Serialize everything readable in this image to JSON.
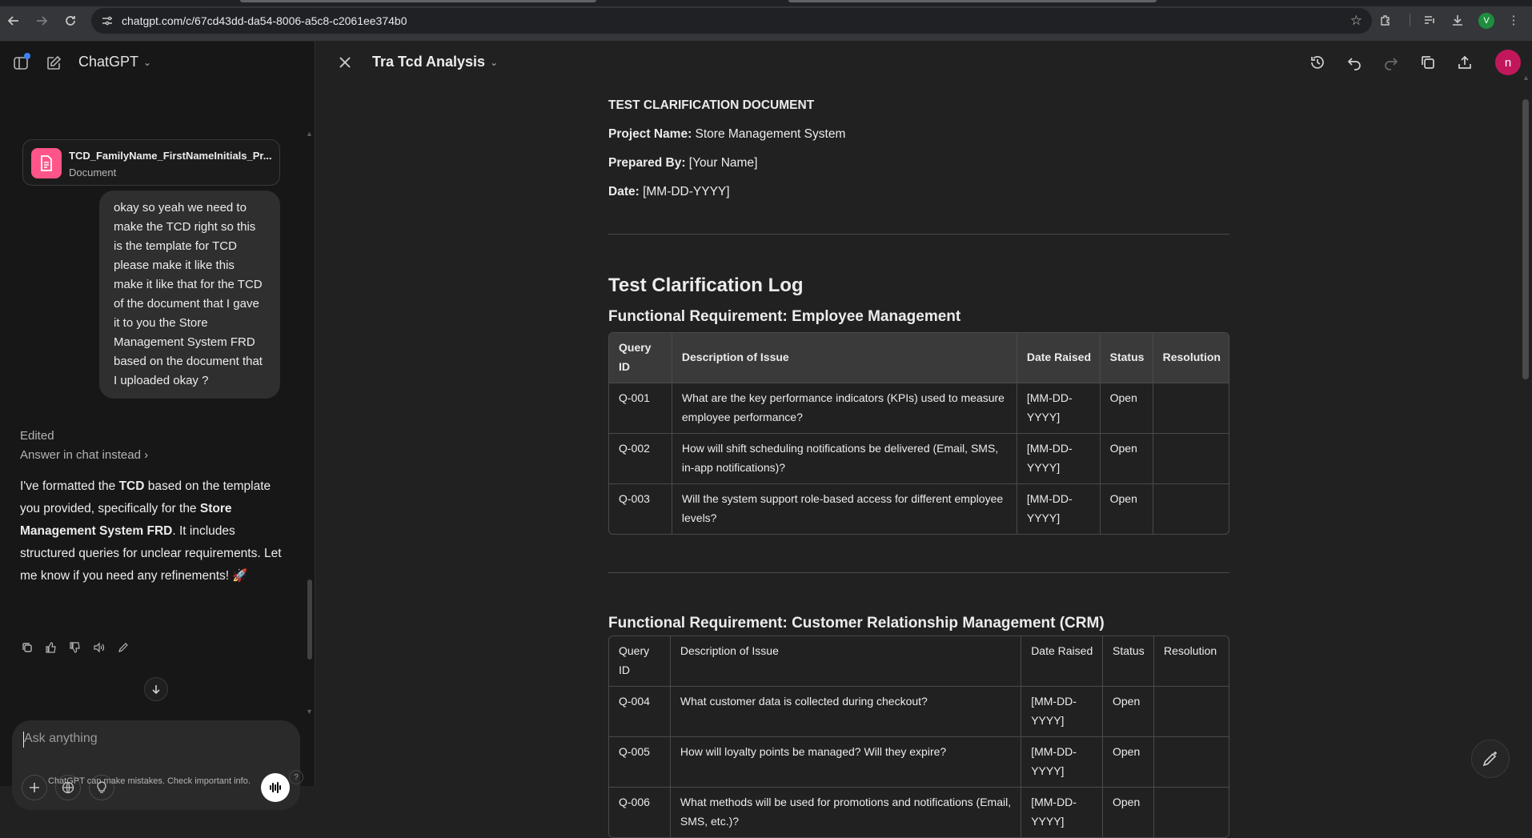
{
  "browser": {
    "url": "chatgpt.com/c/67cd43dd-da54-8006-a5c8-c2061ee374b0",
    "profile_initial": "V"
  },
  "sidebar": {
    "title": "ChatGPT",
    "attachment": {
      "name": "TCD_FamilyName_FirstNameInitials_Pr...",
      "type": "Document"
    },
    "user_message": "okay so yeah we need to make the TCD right so this is the template for TCD please make it like this make it like that for the TCD of the document that I gave it to you the Store Management System FRD based on the document that I uploaded okay ?",
    "edited_label": "Edited",
    "answer_in_chat": "Answer in chat instead",
    "assistant_message": {
      "p1": "I've formatted the ",
      "b1": "TCD",
      "p2": " based on the template you provided, specifically for the ",
      "b2": "Store Management System FRD",
      "p3": ". It includes structured queries for unclear requirements. Let me know if you need any refinements! 🚀"
    },
    "composer_placeholder": "Ask anything",
    "disclaimer": "ChatGPT can make mistakes. Check important info.",
    "help": "?"
  },
  "canvas": {
    "title": "Tra Tcd Analysis",
    "avatar_initial": "n",
    "doc": {
      "header": "TEST CLARIFICATION DOCUMENT",
      "project_label": "Project Name:",
      "project_value": " Store Management System",
      "prepared_label": "Prepared By:",
      "prepared_value": " [Your Name]",
      "date_label": "Date:",
      "date_value": " [MM-DD-YYYY]",
      "log_title": "Test Clarification Log",
      "section1": {
        "title": "Functional Requirement: Employee Management",
        "headers": [
          "Query ID",
          "Description of Issue",
          "Date Raised",
          "Status",
          "Resolution"
        ],
        "rows": [
          [
            "Q-001",
            "What are the key performance indicators (KPIs) used to measure employee performance?",
            "[MM-DD-YYYY]",
            "Open",
            ""
          ],
          [
            "Q-002",
            "How will shift scheduling notifications be delivered (Email, SMS, in-app notifications)?",
            "[MM-DD-YYYY]",
            "Open",
            ""
          ],
          [
            "Q-003",
            "Will the system support role-based access for different employee levels?",
            "[MM-DD-YYYY]",
            "Open",
            ""
          ]
        ]
      },
      "section2": {
        "title": "Functional Requirement: Customer Relationship Management (CRM)",
        "headers": [
          "Query ID",
          "Description of Issue",
          "Date Raised",
          "Status",
          "Resolution"
        ],
        "rows": [
          [
            "Q-004",
            "What customer data is collected during checkout?",
            "[MM-DD-YYYY]",
            "Open",
            ""
          ],
          [
            "Q-005",
            "How will loyalty points be managed? Will they expire?",
            "[MM-DD-YYYY]",
            "Open",
            ""
          ],
          [
            "Q-006",
            "What methods will be used for promotions and notifications (Email, SMS, etc.)?",
            "[MM-DD-YYYY]",
            "Open",
            ""
          ]
        ]
      }
    }
  },
  "colors": {
    "file_icon_bg": "#ff5588",
    "canvas_avatar_bg": "#c2185b",
    "chrome_avatar_bg": "#1e8e3e"
  }
}
